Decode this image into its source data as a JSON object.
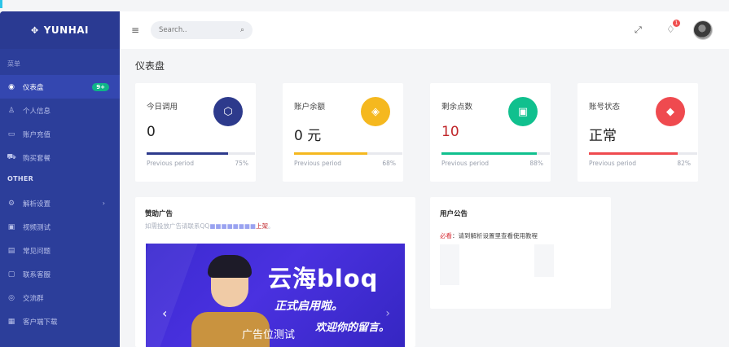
{
  "sidebar": {
    "brand": "YUNHAI",
    "brand_icon": "✥",
    "section_menu": "菜单",
    "section_other": "OTHER",
    "items": [
      {
        "label": "仪表盘",
        "icon": "◉",
        "badge": "9+",
        "active": true
      },
      {
        "label": "个人信息",
        "icon": "♙"
      },
      {
        "label": "账户充值",
        "icon": "▭"
      },
      {
        "label": "购买套餐",
        "icon": "⛟"
      },
      {
        "label": "解析设置",
        "icon": "⚙",
        "chevron": "›"
      },
      {
        "label": "视频测试",
        "icon": "▣"
      },
      {
        "label": "常见问题",
        "icon": "▤"
      },
      {
        "label": "联系客服",
        "icon": "▢"
      },
      {
        "label": "交流群",
        "icon": "◎"
      },
      {
        "label": "客户端下载",
        "icon": "▦"
      }
    ]
  },
  "topbar": {
    "menu_icon": "≡",
    "search_placeholder": "Search..",
    "search_icon": "⌕",
    "expand_icon": "⤢",
    "bell_icon": "🔔",
    "bell_count": "1"
  },
  "page": {
    "title": "仪表盘"
  },
  "stats": [
    {
      "label": "今日调用",
      "value": "0",
      "icon": "⬡",
      "color": "#2d3a8c",
      "progress": 0.75,
      "period": "Previous period",
      "pct": "75%"
    },
    {
      "label": "账户余额",
      "value": "0 元",
      "icon": "◈",
      "color": "#f5b81f",
      "progress": 0.68,
      "period": "Previous period",
      "pct": "68%"
    },
    {
      "label": "剩余点数",
      "value": "10",
      "icon": "▣",
      "color": "#10c08e",
      "progress": 0.88,
      "period": "Previous period",
      "pct": "88%"
    },
    {
      "label": "账号状态",
      "value": "正常",
      "icon": "◆",
      "color": "#ef4a4f",
      "progress": 0.82,
      "period": "Previous period",
      "pct": "82%"
    }
  ],
  "ad": {
    "title": "赞助广告",
    "sub_prefix": "如需投放广告请联系QQ",
    "sub_blur": "■■■■■■■■",
    "sub_link": "上架",
    "sub_suffix": "。",
    "banner_title": "云海bloq",
    "banner_line1": "正式启用啦。",
    "banner_line2": "欢迎你的留言。",
    "banner_overlay": "广告位测试",
    "prev_icon": "‹",
    "next_icon": "›"
  },
  "notice": {
    "title": "用户公告",
    "must": "必看",
    "text": "：请到解析设置里查看使用教程"
  }
}
